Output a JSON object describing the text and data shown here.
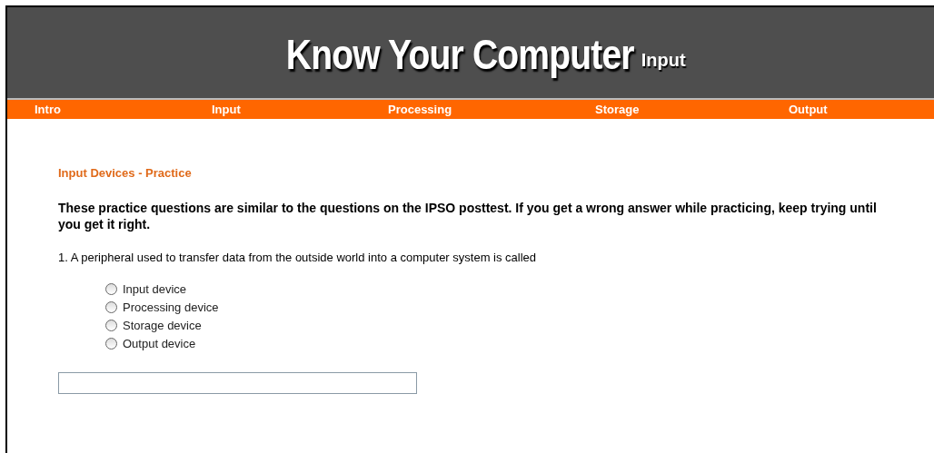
{
  "header": {
    "title": "Know Your Computer",
    "subtitle": "Input"
  },
  "nav": [
    {
      "label": "Intro"
    },
    {
      "label": "Input"
    },
    {
      "label": "Processing"
    },
    {
      "label": "Storage"
    },
    {
      "label": "Output"
    }
  ],
  "content": {
    "heading": "Input Devices - Practice",
    "intro": "These practice questions are similar to the questions on the IPSO posttest. If you get a wrong answer while practicing, keep trying until you get it right.",
    "question": "1. A peripheral used to transfer data from the outside world into a computer system is called",
    "options": [
      {
        "label": "Input device",
        "selected": false
      },
      {
        "label": "Processing device",
        "selected": false
      },
      {
        "label": "Storage device",
        "selected": false
      },
      {
        "label": "Output device",
        "selected": false
      }
    ]
  }
}
